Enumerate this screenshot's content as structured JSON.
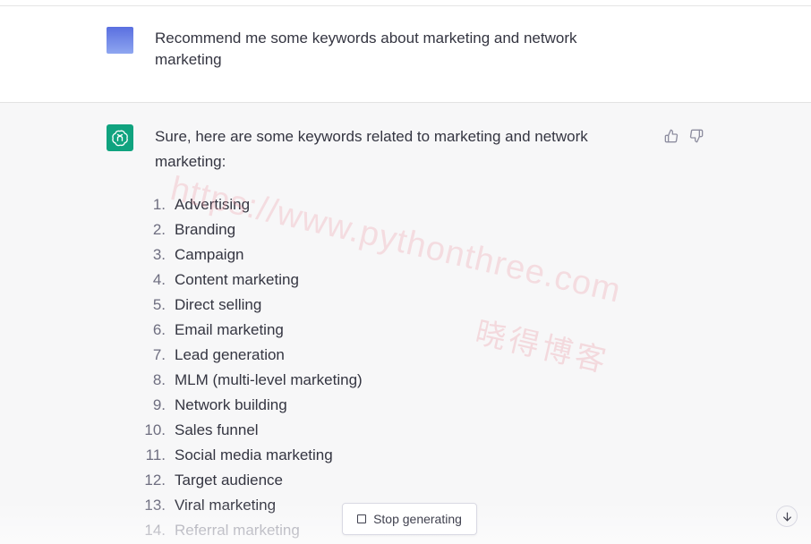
{
  "user_message": {
    "text": "Recommend me some keywords about marketing and network marketing",
    "avatar": "user-avatar-gradient"
  },
  "assistant_message": {
    "intro": "Sure, here are some keywords related to marketing and network marketing:",
    "avatar_icon": "openai-logo-icon",
    "keywords": [
      {
        "num": "1.",
        "text": "Advertising"
      },
      {
        "num": "2.",
        "text": "Branding"
      },
      {
        "num": "3.",
        "text": "Campaign"
      },
      {
        "num": "4.",
        "text": "Content marketing"
      },
      {
        "num": "5.",
        "text": "Direct selling"
      },
      {
        "num": "6.",
        "text": "Email marketing"
      },
      {
        "num": "7.",
        "text": "Lead generation"
      },
      {
        "num": "8.",
        "text": "MLM (multi-level marketing)"
      },
      {
        "num": "9.",
        "text": "Network building"
      },
      {
        "num": "10.",
        "text": "Sales funnel"
      },
      {
        "num": "11.",
        "text": "Social media marketing"
      },
      {
        "num": "12.",
        "text": "Target audience"
      },
      {
        "num": "13.",
        "text": "Viral marketing"
      },
      {
        "num": "14.",
        "text": "Referral marketing"
      }
    ]
  },
  "feedback": {
    "thumbs_up_icon": "thumbs-up-icon",
    "thumbs_down_icon": "thumbs-down-icon"
  },
  "controls": {
    "stop_label": "Stop generating",
    "scroll_icon": "arrow-down-icon"
  },
  "watermark": {
    "url": "https://www.pythonthree.com",
    "cn": "晓得博客"
  },
  "colors": {
    "assistant_bg": "#f7f7f8",
    "gpt_green": "#10a37f",
    "text": "#343541",
    "watermark": "#ec96a0"
  }
}
